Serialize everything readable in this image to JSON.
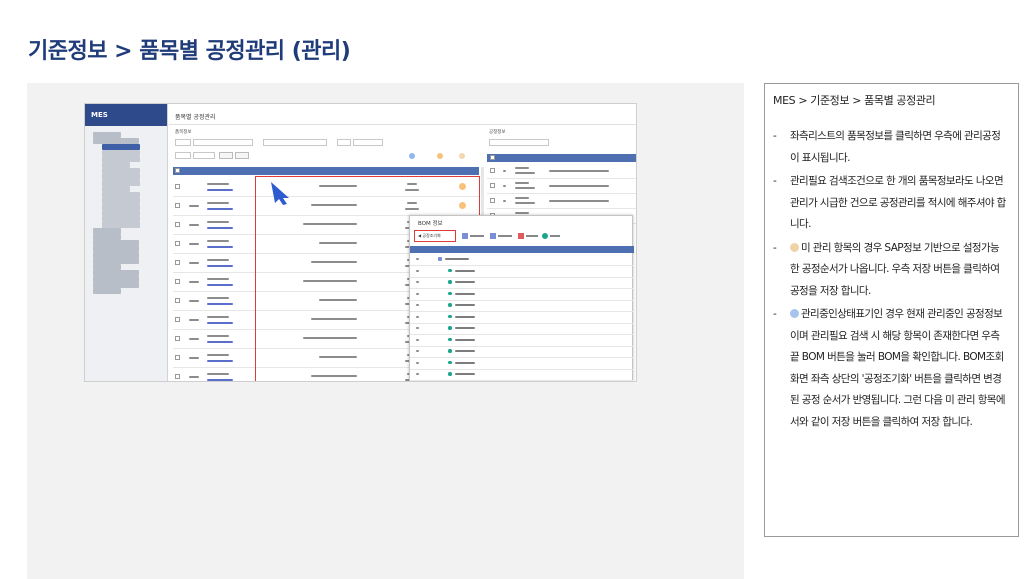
{
  "slide": {
    "title": "기준정보 > 품목별 공정관리 (관리)"
  },
  "screenshot": {
    "app_name": "MES",
    "page_title": "품목별 공정관리",
    "left_grid_title": "품목정보",
    "right_grid_title": "공정정보",
    "bom_popup_title": "BOM 정보",
    "bom_button_label": "공정조기화",
    "colors": {
      "header_blue": "#4f6fb3",
      "highlight_red": "#e03b3b",
      "status_orange": "#f7c27a",
      "status_blue": "#8fb7f2",
      "node_green": "#1aa58e"
    }
  },
  "note": {
    "path": "MES > 기준정보 > 품목별 공정관리",
    "bullet_symbol": "-",
    "items": [
      {
        "text": "좌측리스트의 품목정보를 클릭하면 우측에 관리공정이 표시됩니다."
      },
      {
        "text": "관리필요 검색조건으로 한 개의 품목정보라도 나오면 관리가 시급한 건으로 공정관리를 적시에 해주셔야 합니다."
      },
      {
        "dot_color": "#f0d2a6",
        "text": "미 관리 항목의 경우 SAP정보 기반으로 설정가능한 공정순서가 나옵니다. 우측 저장 버튼을 클릭하여 공정을 저장 합니다."
      },
      {
        "dot_color": "#a7c4ee",
        "text": "관리중인상태표기인 경우 현재 관리중인 공정정보이며 관리필요 검색 시 해당 항목이 존재한다면 우측 끝 BOM 버튼을 눌러 BOM을 확인합니다. BOM조회 화면 좌측 상단의 '공정조기화' 버튼을 클릭하면 변경된 공정 순서가 반영됩니다. 그런 다음 미 관리 항목에서와 같이 저장 버튼을 클릭하여 저장 합니다."
      }
    ]
  }
}
